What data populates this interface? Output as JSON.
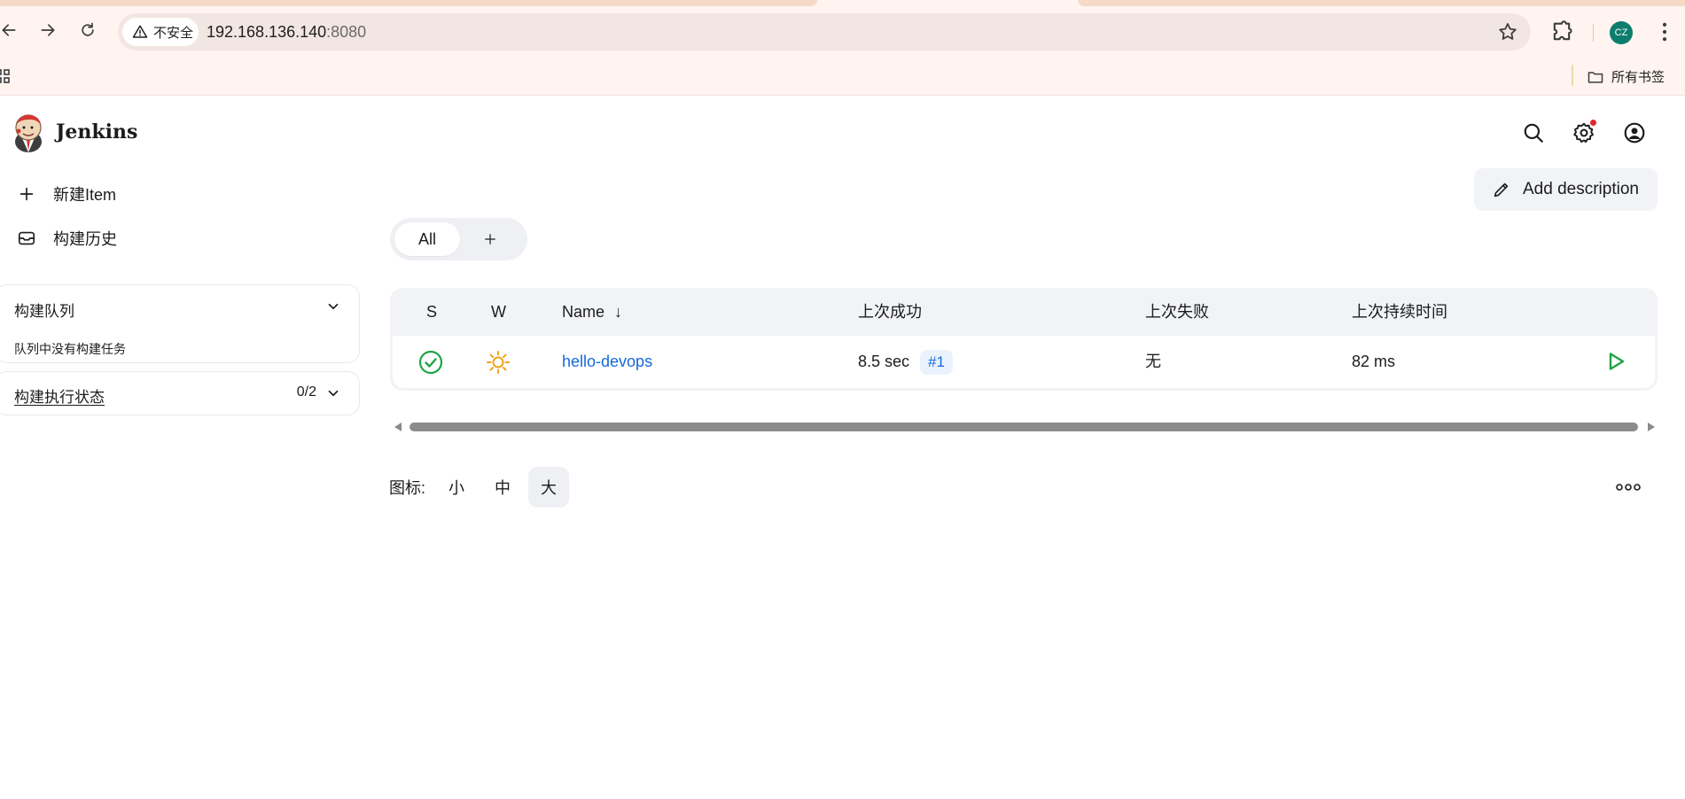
{
  "browser": {
    "security_label": "不安全",
    "url_host": "192.168.136.140",
    "url_port": ":8080",
    "profile_initials": "CZ",
    "all_bookmarks_label": "所有书签"
  },
  "header": {
    "title": "Jenkins"
  },
  "sidebar": {
    "tasks": [
      {
        "label": "新建Item",
        "icon": "plus-icon"
      },
      {
        "label": "构建历史",
        "icon": "inbox-icon"
      }
    ],
    "build_queue": {
      "title": "构建队列",
      "empty_message": "队列中没有构建任务"
    },
    "executors": {
      "title": "构建执行状态",
      "count": "0/2"
    }
  },
  "main": {
    "add_description_label": "Add description",
    "view_tabs": {
      "active": "All"
    },
    "table": {
      "columns": [
        "S",
        "W",
        "Name",
        "上次成功",
        "上次失败",
        "上次持续时间"
      ],
      "sort_indicator": "↓",
      "rows": [
        {
          "status": "success",
          "weather": "sunny",
          "name": "hello-devops",
          "last_success": "8.5 sec",
          "last_success_build": "#1",
          "last_failure": "无",
          "last_duration": "82 ms"
        }
      ]
    },
    "icon_size": {
      "label": "图标:",
      "options": [
        "小",
        "中",
        "大"
      ],
      "selected": "大"
    }
  },
  "colors": {
    "accent_link": "#1469d8",
    "success_green": "#1ea446",
    "weather_sun": "#f0a31c",
    "browser_chrome": "#fff4ef",
    "notification_dot": "#e5262c"
  }
}
